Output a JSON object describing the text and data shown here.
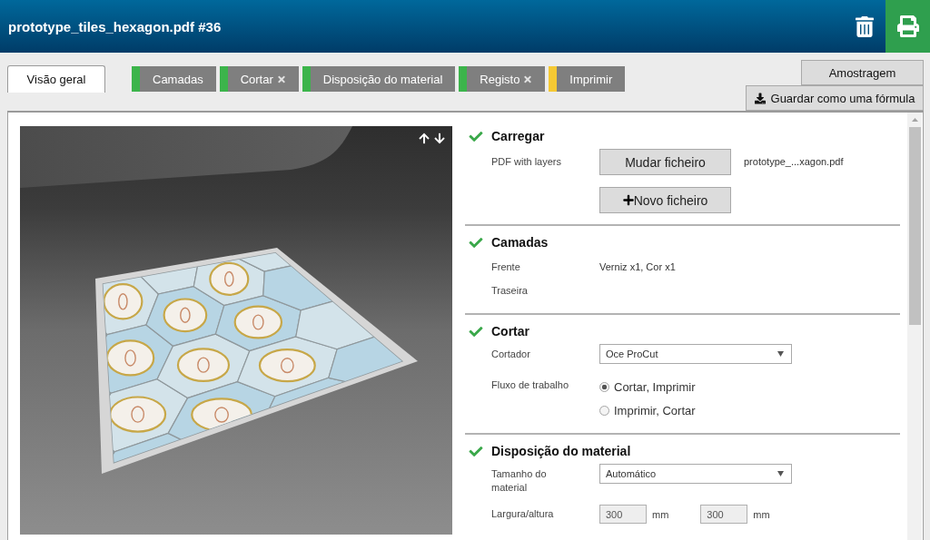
{
  "header": {
    "title": "prototype_tiles_hexagon.pdf #36"
  },
  "tabs": [
    {
      "label": "Visão geral",
      "kind": "overview",
      "selected": true
    },
    {
      "label": "Camadas",
      "kind": "step",
      "selected": false,
      "color": "#3cb44b",
      "crossed": false
    },
    {
      "label": "Cortar",
      "kind": "step",
      "selected": false,
      "color": "#3cb44b",
      "crossed": true
    },
    {
      "label": "Disposição do material",
      "kind": "step",
      "selected": false,
      "color": "#3cb44b",
      "crossed": false
    },
    {
      "label": "Registo",
      "kind": "step",
      "selected": false,
      "color": "#3cb44b",
      "crossed": true
    },
    {
      "label": "Imprimir",
      "kind": "step",
      "selected": false,
      "color": "#f5c933",
      "crossed": false
    }
  ],
  "actions": [
    {
      "label": "Amostragem",
      "kind": "plain"
    },
    {
      "label": "Guardar como uma fórmula",
      "kind": "download"
    }
  ],
  "sections": [
    {
      "title": "Carregar",
      "done": true,
      "rows": [
        {
          "kind": "file",
          "label": "PDF with layers",
          "buttons": [
            {
              "label": "Mudar ficheiro",
              "kind": "plain"
            },
            {
              "label": "Novo ficheiro",
              "kind": "add"
            }
          ],
          "value": "prototype_...xagon.pdf"
        }
      ]
    },
    {
      "title": "Camadas",
      "done": true,
      "rows": [
        {
          "kind": "text",
          "label": "Frente",
          "value": "Verniz x1, Cor x1"
        },
        {
          "kind": "text",
          "label": "Traseira"
        }
      ]
    },
    {
      "title": "Cortar",
      "done": true,
      "rows": [
        {
          "kind": "select",
          "label": "Cortador",
          "value": "Oce ProCut"
        },
        {
          "kind": "radio",
          "label": "Fluxo de trabalho",
          "options": [
            {
              "label": "Cortar, Imprimir",
              "selected": true
            },
            {
              "label": "Imprimir, Cortar",
              "selected": false
            }
          ]
        }
      ]
    },
    {
      "title": "Disposição do material",
      "done": true,
      "rows": [
        {
          "kind": "select",
          "label": "Tamanho do material",
          "value": "Automático"
        },
        {
          "kind": "dimensions",
          "label": "Largura/altura",
          "fields": [
            {
              "value": "300",
              "unit": "mm"
            },
            {
              "value": "300",
              "unit": "mm"
            }
          ]
        }
      ]
    }
  ]
}
